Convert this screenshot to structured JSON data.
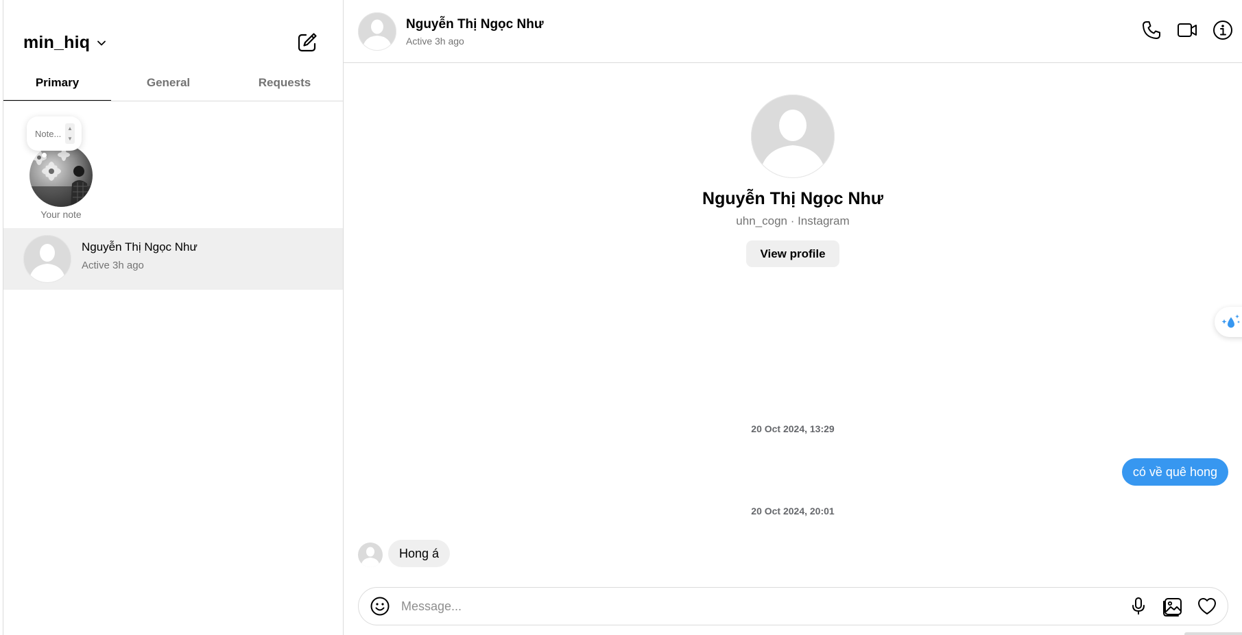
{
  "sidebar": {
    "account_name": "min_hiq",
    "tabs": [
      {
        "label": "Primary",
        "active": true
      },
      {
        "label": "General",
        "active": false
      },
      {
        "label": "Requests",
        "active": false
      }
    ],
    "note": {
      "placeholder": "Note...",
      "caption": "Your note"
    },
    "threads": [
      {
        "name": "Nguyễn Thị Ngọc Như",
        "status": "Active 3h ago",
        "selected": true
      }
    ]
  },
  "chat": {
    "header": {
      "name": "Nguyễn Thị Ngọc Như",
      "status": "Active 3h ago",
      "icons": [
        "phone-icon",
        "video-call-icon",
        "info-icon"
      ]
    },
    "profile": {
      "name": "Nguyễn Thị Ngọc Như",
      "subtitle": "uhn_cogn · Instagram",
      "view_profile_label": "View profile"
    },
    "messages": [
      {
        "type": "timestamp",
        "text": "20 Oct 2024, 13:29"
      },
      {
        "type": "outgoing",
        "text": "có về quê hong"
      },
      {
        "type": "timestamp",
        "text": "20 Oct 2024, 20:01"
      },
      {
        "type": "incoming",
        "text": "Hong á"
      }
    ],
    "composer": {
      "placeholder": "Message...",
      "value": "",
      "icons": [
        "emoji-icon",
        "microphone-icon",
        "image-icon",
        "heart-icon"
      ]
    }
  },
  "colors": {
    "accent_blue": "#3797f0",
    "bubble_gray": "#efefef",
    "secondary_text": "#737373",
    "divider": "#dbdbdb",
    "selected_thread_bg": "#efefef"
  }
}
